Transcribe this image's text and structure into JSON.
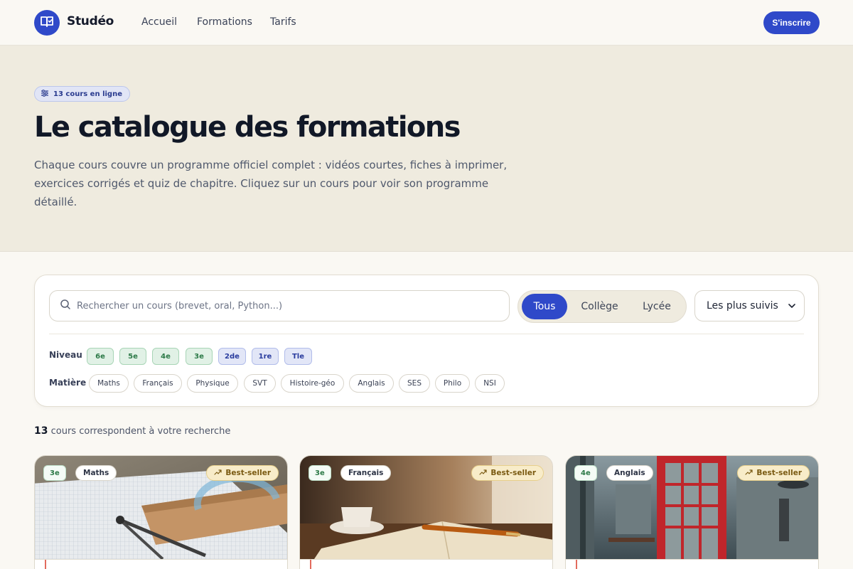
{
  "header": {
    "brand": "Studéo",
    "nav": [
      "Accueil",
      "Formations",
      "Tarifs"
    ],
    "signup_label": "S'inscrire",
    "logo_icon": "book-icon"
  },
  "hero": {
    "badge": "13 cours en ligne",
    "title": "Le catalogue des formations",
    "subtitle": "Chaque cours couvre un programme officiel complet : vidéos courtes, fiches à imprimer, exercices corrigés et quiz de chapitre. Cliquez sur un cours pour voir son programme détaillé."
  },
  "filters": {
    "search_placeholder": "Rechercher un cours (brevet, oral, Python...)",
    "segments": [
      "Tous",
      "Collège",
      "Lycée"
    ],
    "active_segment": "Tous",
    "sort_value": "Les plus suivis",
    "level_label": "Niveau",
    "levels": [
      "6e",
      "5e",
      "4e",
      "3e",
      "2de",
      "1re",
      "Tle"
    ],
    "subject_label": "Matière",
    "subjects": [
      "Maths",
      "Français",
      "Physique",
      "SVT",
      "Histoire-géo",
      "Anglais",
      "SES",
      "Philo",
      "NSI"
    ]
  },
  "results": {
    "count": "13",
    "text": "cours correspondent à votre recherche"
  },
  "cards": [
    {
      "level": "3e",
      "subject": "Maths",
      "badge": "Best-seller"
    },
    {
      "level": "3e",
      "subject": "Français",
      "badge": "Best-seller"
    },
    {
      "level": "4e",
      "subject": "Anglais",
      "badge": "Best-seller"
    }
  ],
  "colors": {
    "accent": "#2f49c9",
    "hero_bg": "#efebdf",
    "page_bg": "#faf8f3",
    "college_chip": "#e1f1e6",
    "lycee_chip": "#e2e6f7",
    "bestseller_bg": "#f8ecc9"
  }
}
